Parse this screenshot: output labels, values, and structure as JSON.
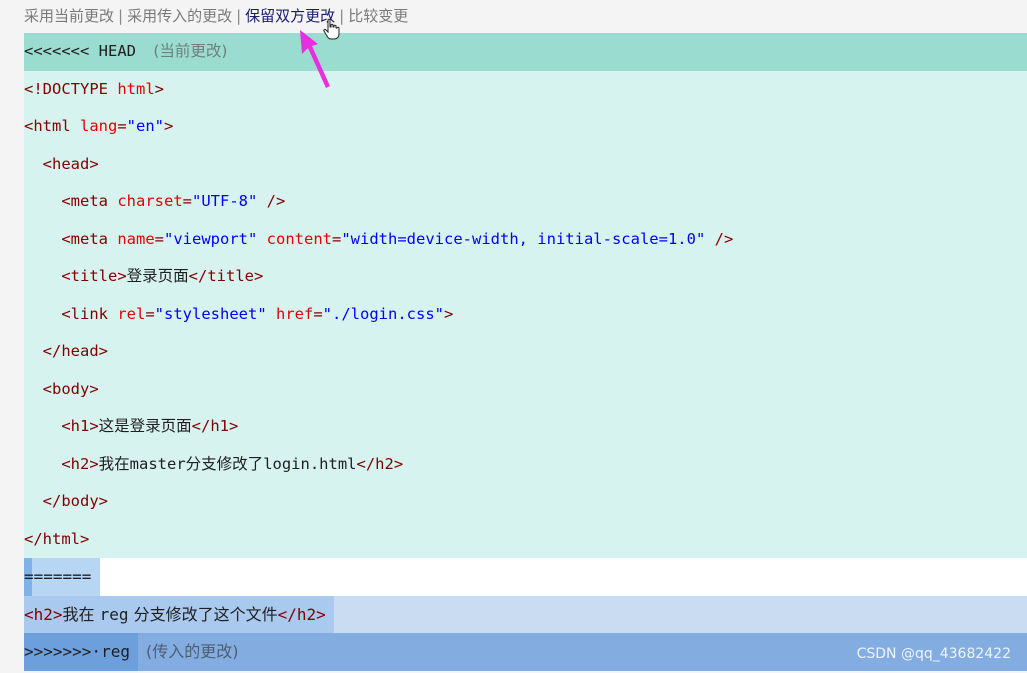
{
  "codelens": {
    "accept_current": "采用当前更改",
    "accept_incoming": "采用传入的更改",
    "accept_both": "保留双方更改",
    "compare": "比较变更",
    "separator": "|"
  },
  "conflict": {
    "current_marker": "<<<<<<< HEAD",
    "current_hint": "(当前更改)",
    "divider": "=======",
    "incoming_marker": ">>>>>>>·reg",
    "incoming_hint": "(传入的更改)"
  },
  "current_lines": [
    {
      "indent": "",
      "parts": [
        {
          "k": "tag",
          "t": "<!DOCTYPE "
        },
        {
          "k": "attr",
          "t": "html"
        },
        {
          "k": "tag",
          "t": ">"
        }
      ]
    },
    {
      "indent": "",
      "parts": [
        {
          "k": "tag",
          "t": "<html "
        },
        {
          "k": "attr",
          "t": "lang"
        },
        {
          "k": "tag",
          "t": "="
        },
        {
          "k": "val",
          "t": "\"en\""
        },
        {
          "k": "tag",
          "t": ">"
        }
      ]
    },
    {
      "indent": "  ",
      "parts": [
        {
          "k": "tag",
          "t": "<head>"
        }
      ]
    },
    {
      "indent": "    ",
      "parts": [
        {
          "k": "tag",
          "t": "<meta "
        },
        {
          "k": "attr",
          "t": "charset"
        },
        {
          "k": "tag",
          "t": "="
        },
        {
          "k": "val",
          "t": "\"UTF-8\""
        },
        {
          "k": "tag",
          "t": " />"
        }
      ]
    },
    {
      "indent": "    ",
      "parts": [
        {
          "k": "tag",
          "t": "<meta "
        },
        {
          "k": "attr",
          "t": "name"
        },
        {
          "k": "tag",
          "t": "="
        },
        {
          "k": "val",
          "t": "\"viewport\""
        },
        {
          "k": "tag",
          "t": " "
        },
        {
          "k": "attr",
          "t": "content"
        },
        {
          "k": "tag",
          "t": "="
        },
        {
          "k": "val",
          "t": "\"width=device-width, initial-scale=1.0\""
        },
        {
          "k": "tag",
          "t": " />"
        }
      ]
    },
    {
      "indent": "    ",
      "parts": [
        {
          "k": "tag",
          "t": "<title>"
        },
        {
          "k": "txt",
          "t": "登录页面"
        },
        {
          "k": "tag",
          "t": "</title>"
        }
      ]
    },
    {
      "indent": "    ",
      "parts": [
        {
          "k": "tag",
          "t": "<link "
        },
        {
          "k": "attr",
          "t": "rel"
        },
        {
          "k": "tag",
          "t": "="
        },
        {
          "k": "val",
          "t": "\"stylesheet\""
        },
        {
          "k": "tag",
          "t": " "
        },
        {
          "k": "attr",
          "t": "href"
        },
        {
          "k": "tag",
          "t": "="
        },
        {
          "k": "val",
          "t": "\"./login.css\""
        },
        {
          "k": "tag",
          "t": ">"
        }
      ]
    },
    {
      "indent": "  ",
      "parts": [
        {
          "k": "tag",
          "t": "</head>"
        }
      ]
    },
    {
      "indent": "  ",
      "parts": [
        {
          "k": "tag",
          "t": "<body>"
        }
      ]
    },
    {
      "indent": "    ",
      "parts": [
        {
          "k": "tag",
          "t": "<h1>"
        },
        {
          "k": "txt",
          "t": "这是登录页面"
        },
        {
          "k": "tag",
          "t": "</h1>"
        }
      ]
    },
    {
      "indent": "    ",
      "parts": [
        {
          "k": "tag",
          "t": "<h2>"
        },
        {
          "k": "txt",
          "t": "我在"
        },
        {
          "k": "plain",
          "t": "master"
        },
        {
          "k": "txt",
          "t": "分支修改了"
        },
        {
          "k": "plain",
          "t": "login.html"
        },
        {
          "k": "tag",
          "t": "</h2>"
        }
      ]
    },
    {
      "indent": "  ",
      "parts": [
        {
          "k": "tag",
          "t": "</body>"
        }
      ]
    },
    {
      "indent": "",
      "parts": [
        {
          "k": "tag",
          "t": "</html>"
        }
      ]
    }
  ],
  "incoming_line": [
    {
      "k": "tag",
      "t": "<h2>"
    },
    {
      "k": "txt",
      "t": "我在 "
    },
    {
      "k": "plain",
      "t": "reg"
    },
    {
      "k": "txt",
      "t": " 分支修改了这个文件"
    },
    {
      "k": "tag",
      "t": "</h2>"
    }
  ],
  "watermark": "CSDN @qq_43682422",
  "colors": {
    "current_header": "#9bdcd1",
    "current_body": "#d7f3ef",
    "incoming_header": "#6c9fdc",
    "incoming_body": "#a9c9ee",
    "annotation_arrow": "#e82fe0"
  }
}
